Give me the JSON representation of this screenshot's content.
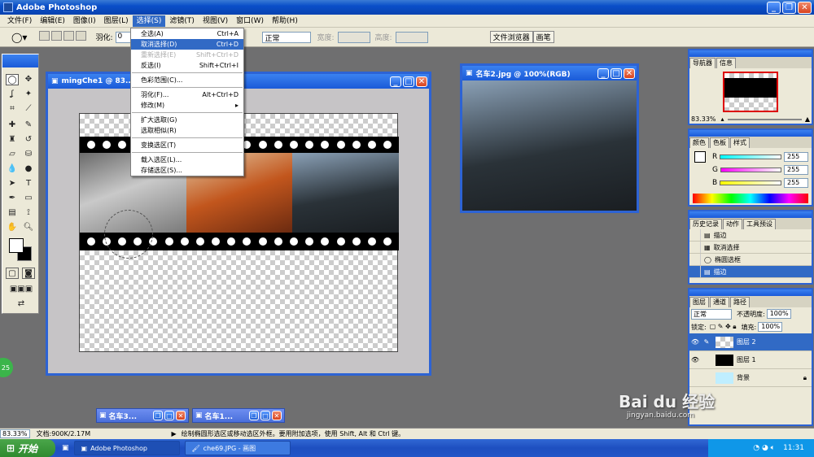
{
  "app": {
    "title": "Adobe Photoshop"
  },
  "menubar": {
    "items": [
      "文件(F)",
      "编辑(E)",
      "图像(I)",
      "图层(L)",
      "选择(S)",
      "滤镜(T)",
      "视图(V)",
      "窗口(W)",
      "帮助(H)"
    ]
  },
  "options": {
    "feather_label": "羽化:",
    "feather_value": "0",
    "style_value": "正常",
    "width_label": "宽度:",
    "height_label": "高度:",
    "tab_file_browser": "文件浏览器",
    "tab_brushes": "画笔"
  },
  "select_menu": {
    "items": [
      {
        "label": "全选(A)",
        "shortcut": "Ctrl+A",
        "state": "normal"
      },
      {
        "label": "取消选择(D)",
        "shortcut": "Ctrl+D",
        "state": "highlight"
      },
      {
        "label": "重新选择(E)",
        "shortcut": "Shift+Ctrl+D",
        "state": "disabled"
      },
      {
        "label": "反选(I)",
        "shortcut": "Shift+Ctrl+I",
        "state": "normal"
      },
      {
        "label": "色彩范围(C)...",
        "shortcut": "",
        "state": "normal"
      },
      {
        "label": "羽化(F)...",
        "shortcut": "Alt+Ctrl+D",
        "state": "normal"
      },
      {
        "label": "修改(M)",
        "shortcut": "▸",
        "state": "normal"
      },
      {
        "label": "扩大选取(G)",
        "shortcut": "",
        "state": "normal"
      },
      {
        "label": "选取相似(R)",
        "shortcut": "",
        "state": "normal"
      },
      {
        "label": "变换选区(T)",
        "shortcut": "",
        "state": "normal"
      },
      {
        "label": "载入选区(L)...",
        "shortcut": "",
        "state": "normal"
      },
      {
        "label": "存储选区(S)...",
        "shortcut": "",
        "state": "normal"
      }
    ]
  },
  "doc_main": {
    "title": "mingChe1 @ 83..."
  },
  "doc_car2": {
    "title": "名车2.jpg @ 100%(RGB)"
  },
  "minimized": [
    {
      "title": "名车3..."
    },
    {
      "title": "名车1..."
    }
  ],
  "navigator": {
    "tabs": [
      "导航器",
      "信息"
    ],
    "zoom": "83.33%"
  },
  "color_panel": {
    "tabs": [
      "颜色",
      "色板",
      "样式"
    ],
    "r": "255",
    "g": "255",
    "b": "255",
    "r_label": "R",
    "g_label": "G",
    "b_label": "B"
  },
  "history": {
    "tabs": [
      "历史记录",
      "动作",
      "工具预设"
    ],
    "items": [
      {
        "label": "描边",
        "selected": false
      },
      {
        "label": "取消选择",
        "selected": false
      },
      {
        "label": "椭圆选框",
        "selected": false
      },
      {
        "label": "描边",
        "selected": true
      }
    ]
  },
  "layers": {
    "tabs": [
      "图层",
      "通道",
      "路径"
    ],
    "mode": "正常",
    "opacity_label": "不透明度:",
    "opacity": "100%",
    "lock_label": "锁定:",
    "fill_label": "填充:",
    "fill": "100%",
    "items": [
      {
        "name": "图层 2",
        "selected": true
      },
      {
        "name": "图层 1",
        "selected": false
      },
      {
        "name": "背景",
        "selected": false
      }
    ]
  },
  "status": {
    "zoom": "83.33%",
    "doc": "文档:900K/2.17M",
    "hint": "绘制椭圆形选区或移动选区外框。要用附加选项，使用 Shift, Alt 和 Ctrl 键。"
  },
  "taskbar": {
    "start": "开始",
    "tasks": [
      "Adobe Photoshop",
      "che69.JPG - 画图"
    ],
    "clock": "11:31"
  },
  "watermark": {
    "brand": "Bai du 经验",
    "url": "jingyan.baidu.com"
  },
  "badge": "25",
  "colors": {
    "xp_blue": "#2d63d4",
    "menu_highlight": "#316ac5",
    "panel_bg": "#ece9d8"
  }
}
